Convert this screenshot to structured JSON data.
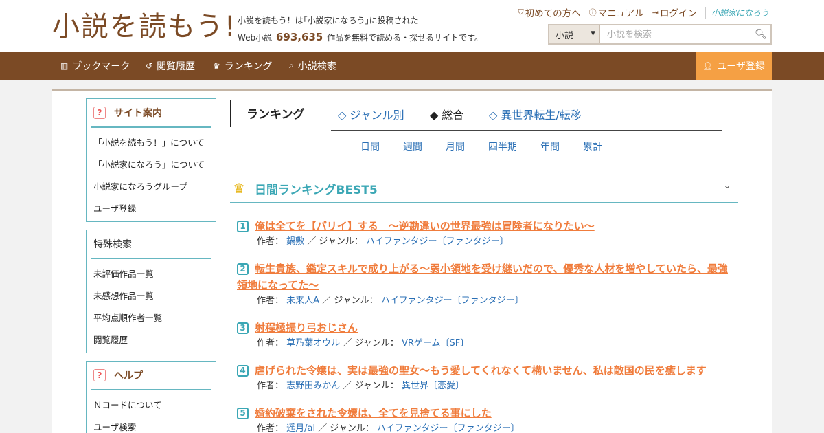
{
  "header": {
    "logo_text": "小説を読もう!",
    "tagline_line1": "小説を読もう！は｢小説家になろう｣に投稿された",
    "tagline_prefix": "Web小説",
    "tagline_count": "693,635",
    "tagline_suffix": "作品を無料で読める・探せるサイトです。",
    "links": [
      {
        "label": "初めての方へ",
        "icon": "shield-icon"
      },
      {
        "label": "マニュアル",
        "icon": "question-circle-icon"
      },
      {
        "label": "ログイン",
        "icon": "login-icon"
      }
    ],
    "partner_logo": "小説家になろう",
    "search": {
      "category": "小説",
      "placeholder": "小説を検索"
    }
  },
  "nav": {
    "items": [
      {
        "label": "ブックマーク",
        "icon": "bookmark-icon"
      },
      {
        "label": "閲覧履歴",
        "icon": "history-icon"
      },
      {
        "label": "ランキング",
        "icon": "crown-icon"
      },
      {
        "label": "小説検索",
        "icon": "search-icon"
      }
    ],
    "register": "ユーザ登録"
  },
  "sidebar": {
    "site_guide": {
      "title": "サイト案内",
      "items": [
        "「小説を読もう！」について",
        "「小説家になろう」について",
        "小説家になろうグループ",
        "ユーザ登録"
      ]
    },
    "special_search": {
      "title": "特殊検索",
      "items": [
        "未評価作品一覧",
        "未感想作品一覧",
        "平均点順作者一覧",
        "閲覧履歴"
      ]
    },
    "help": {
      "title": "ヘルプ",
      "items": [
        "Ｎコードについて",
        "ユーザ検索"
      ]
    }
  },
  "ranking": {
    "title": "ランキング",
    "tabs": [
      {
        "label": "◇ ジャンル別",
        "active": false
      },
      {
        "label": "◆ 総合",
        "active": true
      },
      {
        "label": "◇ 異世界転生/転移",
        "active": false
      }
    ],
    "periods": [
      "日間",
      "週間",
      "月間",
      "四半期",
      "年間",
      "累計"
    ],
    "best_title": "日間ランキングBEST5",
    "author_label": "作者：",
    "genre_label": "／ ジャンル：",
    "items": [
      {
        "rank": "1",
        "title": "俺は全てを【パリイ】する　〜逆勘違いの世界最強は冒険者になりたい〜",
        "author": "鍋敷",
        "genre": "ハイファンタジー〔ファンタジー〕"
      },
      {
        "rank": "2",
        "title": "転生貴族、鑑定スキルで成り上がる～弱小領地を受け継いだので、優秀な人材を増やしていたら、最強領地になってた～",
        "author": "未来人A",
        "genre": "ハイファンタジー〔ファンタジー〕"
      },
      {
        "rank": "3",
        "title": "射程極振り弓おじさん",
        "author": "草乃葉オウル",
        "genre": "VRゲーム〔SF〕"
      },
      {
        "rank": "4",
        "title": "虐げられた令嬢は、実は最強の聖女～もう愛してくれなくて構いません、私は敵国の民を癒します",
        "author": "志野田みかん",
        "genre": "異世界〔恋愛〕"
      },
      {
        "rank": "5",
        "title": "婚約破棄をされた令嬢は、全てを見捨てる事にした",
        "author": "遥月/al",
        "genre": "ハイファンタジー〔ファンタジー〕"
      }
    ]
  },
  "colors": {
    "brand_brown": "#7b4a25",
    "accent_teal": "#3ba7b5",
    "title_orange": "#f07c3c",
    "register_orange": "#f5a044",
    "link_blue": "#2a6fb5"
  }
}
